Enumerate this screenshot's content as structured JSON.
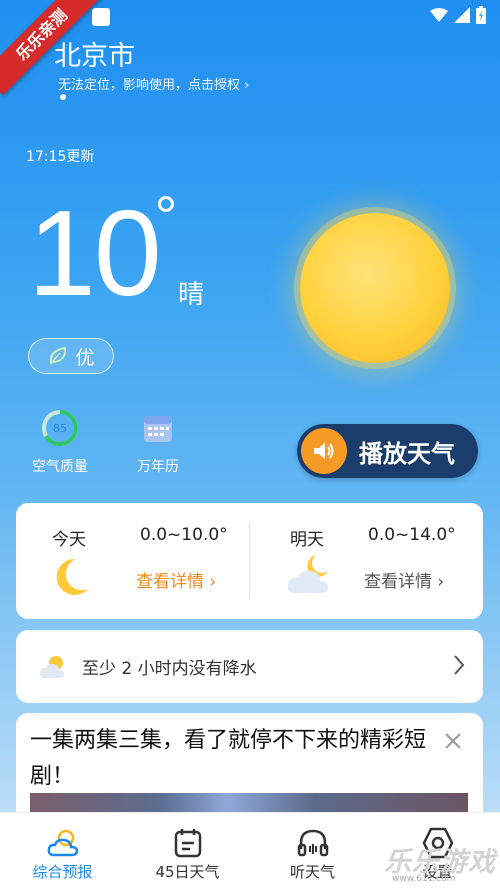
{
  "ribbon": {
    "label": "乐乐亲测"
  },
  "location": {
    "city": "北京市",
    "hint": "无法定位，影响使用，点击授权 ›"
  },
  "weather": {
    "update_time": "17:15更新",
    "temperature": "10",
    "condition": "晴",
    "aqi_label": "优"
  },
  "quick_actions": [
    {
      "label": "空气质量",
      "value": "85",
      "icon": "aqi-gauge-icon"
    },
    {
      "label": "万年历",
      "icon": "calendar-icon"
    }
  ],
  "play_button": {
    "label": "播放天气"
  },
  "forecast": {
    "today": {
      "day": "今天",
      "range": "0.0~10.0°",
      "link": "查看详情 ›",
      "icon": "moon-icon"
    },
    "tomorrow": {
      "day": "明天",
      "range": "0.0~14.0°",
      "link": "查看详情 ›",
      "icon": "cloud-moon-icon"
    }
  },
  "rain_notice": {
    "text": "至少 2 小时内没有降水"
  },
  "ad": {
    "text": "一集两集三集，看了就停不下来的精彩短剧！"
  },
  "tabs": [
    {
      "label": "综合预报",
      "icon": "cloud-sun-icon",
      "active": true
    },
    {
      "label": "45日天气",
      "icon": "calendar-45-icon",
      "active": false
    },
    {
      "label": "听天气",
      "icon": "headphones-icon",
      "active": false
    },
    {
      "label": "设置",
      "icon": "settings-icon",
      "active": false
    }
  ],
  "watermark": {
    "text": "乐乐游戏",
    "url": "www.611.com"
  },
  "colors": {
    "accent": "#1a8bea",
    "link_orange": "#f08a1a",
    "play_button_bg": "#1a3d6b",
    "play_circle": "#f79a26"
  }
}
